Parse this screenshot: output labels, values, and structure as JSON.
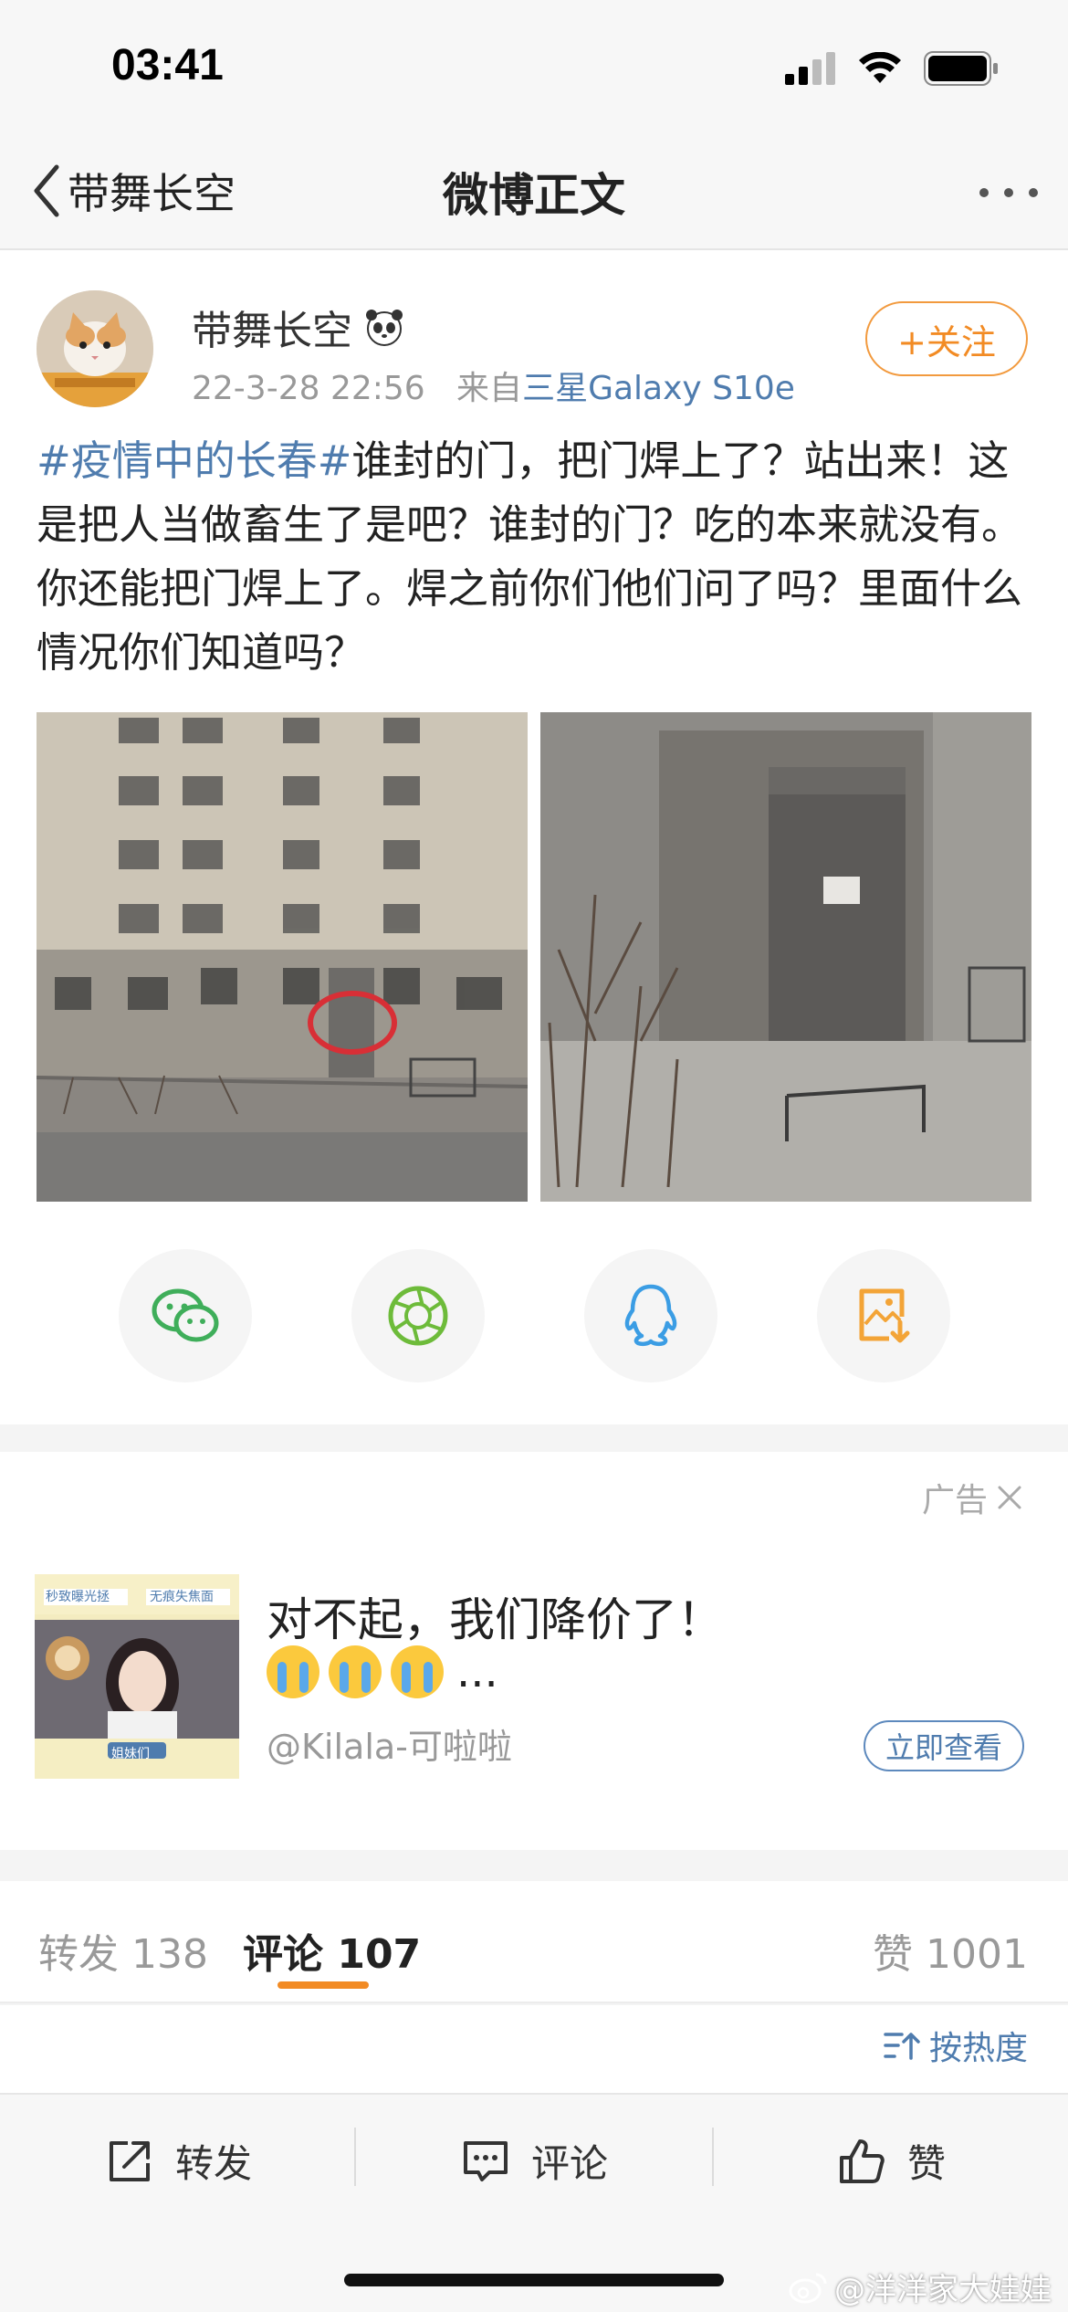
{
  "status_bar": {
    "time": "03:41"
  },
  "nav": {
    "back_label": "带舞长空",
    "title": "微博正文"
  },
  "post": {
    "author": "带舞长空",
    "timestamp": "22-3-28 22:56",
    "source_prefix": "来自",
    "source_device": "三星Galaxy S10e",
    "follow_label": "+关注",
    "hashtag": "#疫情中的长春#",
    "body": "谁封的门，把门焊上了？站出来！这是把人当做畜生了是吧？谁封的门？吃的本来就没有。你还能把门焊上了。焊之前你们他们问了吗？里面什么情况你们知道吗？"
  },
  "share_buttons": [
    {
      "icon": "wechat-icon",
      "color": "#3fae5a"
    },
    {
      "icon": "moments-icon",
      "color": "#6dbb3a"
    },
    {
      "icon": "qq-icon",
      "color": "#3b9de4"
    },
    {
      "icon": "save-image-icon",
      "color": "#f3a437"
    }
  ],
  "ad": {
    "tag": "广告",
    "title": "对不起，我们降价了！",
    "ellipsis": "...",
    "account": "@Kilala-可啦啦",
    "cta": "立即查看",
    "thumb_top_left": "秒致曝光拯",
    "thumb_top_right": "无痕失焦面",
    "thumb_badge": "姐妹们"
  },
  "tabs": {
    "repost_label": "转发",
    "repost_count": "138",
    "comment_label": "评论",
    "comment_count": "107",
    "like_label": "赞",
    "like_count": "1001"
  },
  "sort": {
    "label": "按热度"
  },
  "bottom_bar": {
    "repost": "转发",
    "comment": "评论",
    "like": "赞"
  },
  "watermark": "@洋洋家大娃娃",
  "colors": {
    "link": "#4f7cae",
    "accent": "#f28b24"
  }
}
